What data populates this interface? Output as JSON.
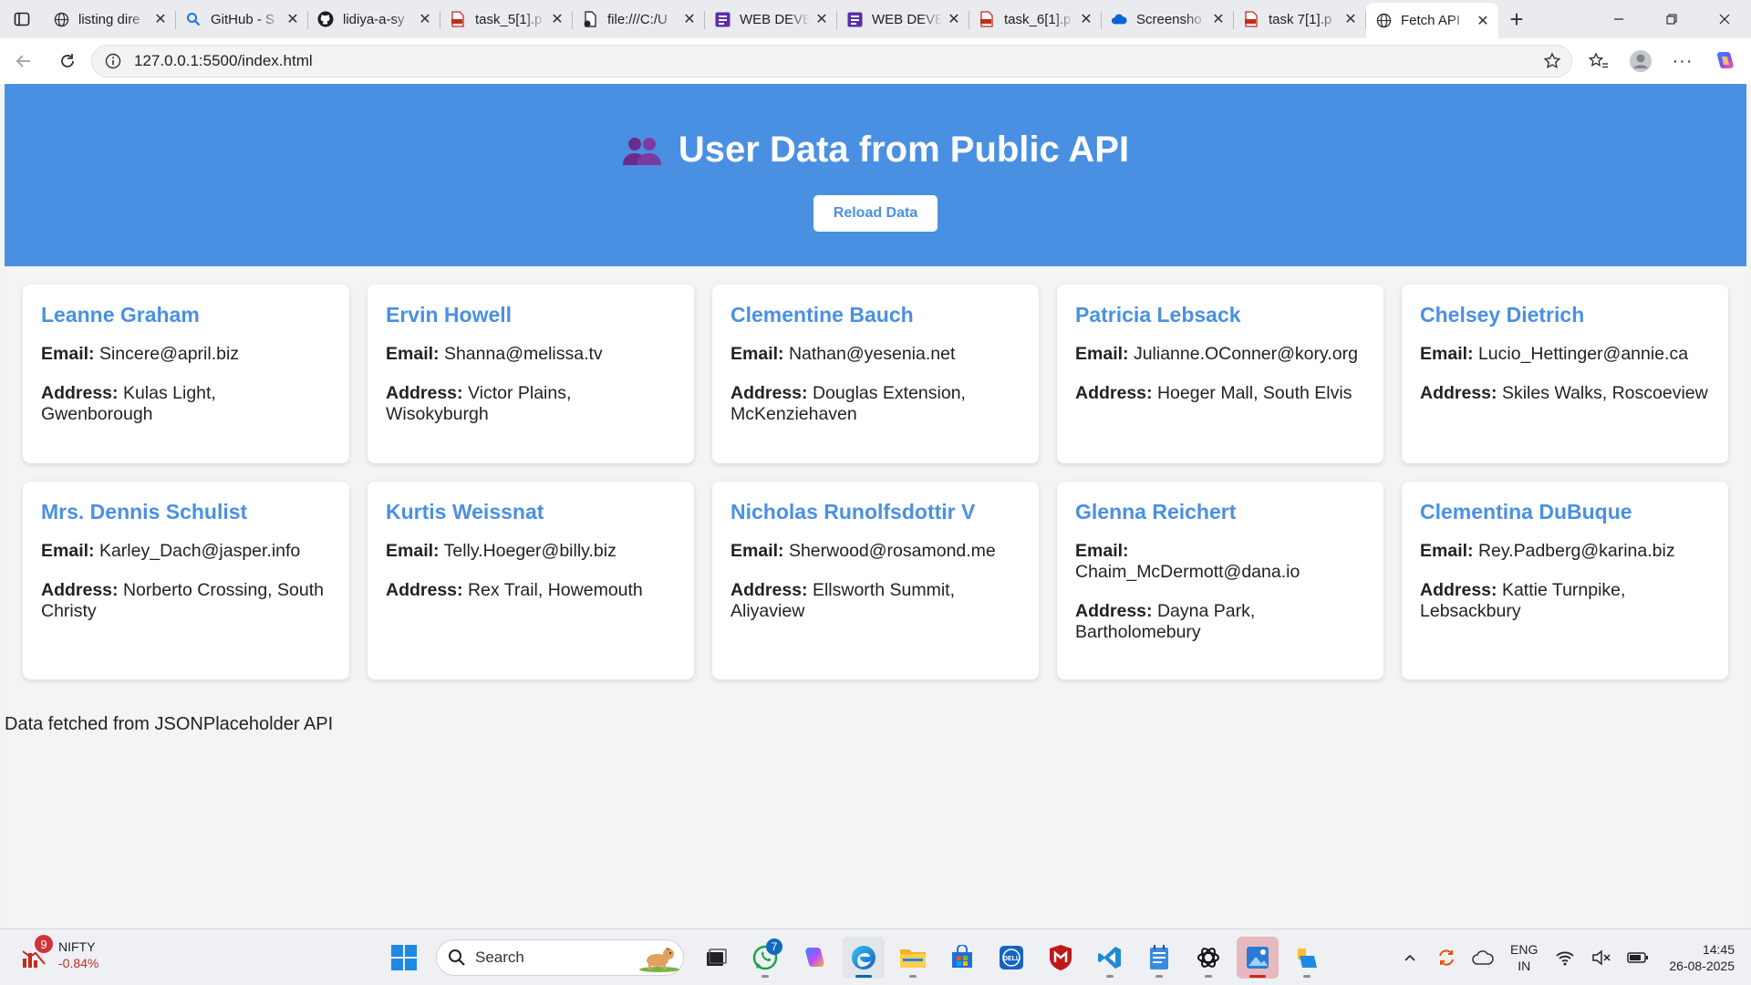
{
  "browser": {
    "tabs": [
      {
        "title": "listing dire",
        "icon": "globe-icon"
      },
      {
        "title": "GitHub - S",
        "icon": "search-icon"
      },
      {
        "title": "lidiya-a-sy",
        "icon": "github-icon"
      },
      {
        "title": "task_5[1].p",
        "icon": "pdf-icon"
      },
      {
        "title": "file:///C:/U",
        "icon": "file-icon"
      },
      {
        "title": "WEB DEVE",
        "icon": "doc-icon"
      },
      {
        "title": "WEB DEVE",
        "icon": "doc-icon"
      },
      {
        "title": "task_6[1].p",
        "icon": "pdf-icon"
      },
      {
        "title": "Screensho",
        "icon": "onedrive-icon"
      },
      {
        "title": "task 7[1].p",
        "icon": "pdf-icon"
      },
      {
        "title": "Fetch API",
        "icon": "globe-icon",
        "active": true
      }
    ],
    "url": "127.0.0.1:5500/index.html"
  },
  "page": {
    "title": "User Data from Public API",
    "reload_label": "Reload Data",
    "email_label": "Email:",
    "address_label": "Address:",
    "users": [
      {
        "name": "Leanne Graham",
        "email": "Sincere@april.biz",
        "address": "Kulas Light, Gwenborough"
      },
      {
        "name": "Ervin Howell",
        "email": "Shanna@melissa.tv",
        "address": "Victor Plains, Wisokyburgh"
      },
      {
        "name": "Clementine Bauch",
        "email": "Nathan@yesenia.net",
        "address": "Douglas Extension, McKenziehaven"
      },
      {
        "name": "Patricia Lebsack",
        "email": "Julianne.OConner@kory.org",
        "address": "Hoeger Mall, South Elvis"
      },
      {
        "name": "Chelsey Dietrich",
        "email": "Lucio_Hettinger@annie.ca",
        "address": "Skiles Walks, Roscoeview"
      },
      {
        "name": "Mrs. Dennis Schulist",
        "email": "Karley_Dach@jasper.info",
        "address": "Norberto Crossing, South Christy"
      },
      {
        "name": "Kurtis Weissnat",
        "email": "Telly.Hoeger@billy.biz",
        "address": "Rex Trail, Howemouth"
      },
      {
        "name": "Nicholas Runolfsdottir V",
        "email": "Sherwood@rosamond.me",
        "address": "Ellsworth Summit, Aliyaview"
      },
      {
        "name": "Glenna Reichert",
        "email": "Chaim_McDermott@dana.io",
        "address": "Dayna Park, Bartholomebury"
      },
      {
        "name": "Clementina DuBuque",
        "email": "Rey.Padberg@karina.biz",
        "address": "Kattie Turnpike, Lebsackbury"
      }
    ],
    "footer": "Data fetched from JSONPlaceholder API"
  },
  "taskbar": {
    "widget": {
      "badge": "9",
      "name": "NIFTY",
      "value": "-0.84%"
    },
    "search_placeholder": "Search",
    "whatsapp_badge": "7",
    "lang_line1": "ENG",
    "lang_line2": "IN",
    "time": "14:45",
    "date": "26-08-2025"
  },
  "colors": {
    "accent": "#4a90e2",
    "card_bg": "#ffffff",
    "page_bg": "#f4f4f4"
  }
}
